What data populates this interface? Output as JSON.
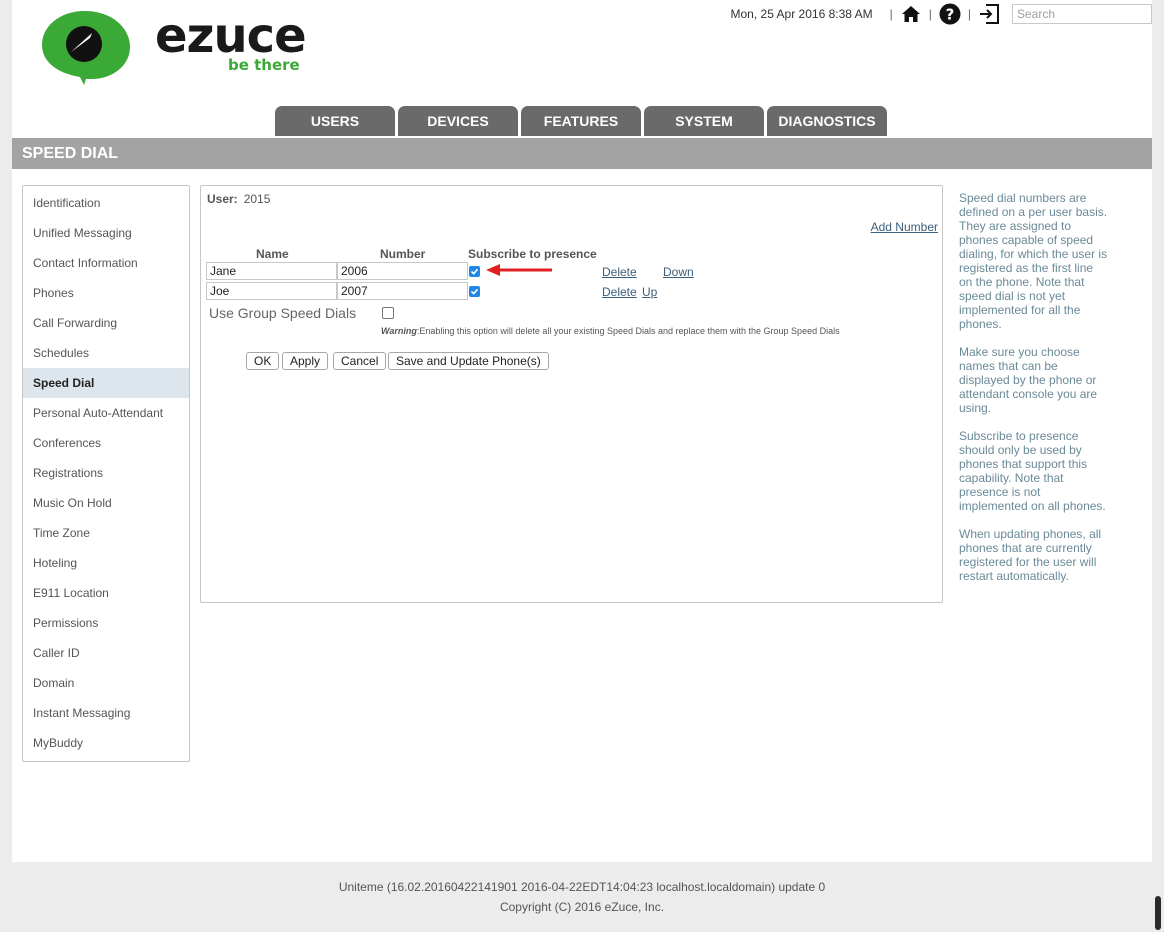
{
  "brand": {
    "name": "ezuce",
    "tagline": "be there",
    "colors": {
      "green": "#3aa935",
      "dark": "#1a1a1a"
    }
  },
  "header": {
    "datetime": "Mon, 25 Apr 2016 8:38 AM",
    "separator": "|",
    "search_placeholder": "Search",
    "icons": [
      "home-icon",
      "help-icon",
      "logout-icon"
    ]
  },
  "tabs": [
    {
      "label": "USERS"
    },
    {
      "label": "DEVICES"
    },
    {
      "label": "FEATURES"
    },
    {
      "label": "SYSTEM"
    },
    {
      "label": "DIAGNOSTICS"
    }
  ],
  "page_title": "SPEED DIAL",
  "sidebar": {
    "items": [
      {
        "label": "Identification"
      },
      {
        "label": "Unified Messaging"
      },
      {
        "label": "Contact Information"
      },
      {
        "label": "Phones"
      },
      {
        "label": "Call Forwarding"
      },
      {
        "label": "Schedules"
      },
      {
        "label": "Speed Dial",
        "active": true
      },
      {
        "label": "Personal Auto-Attendant"
      },
      {
        "label": "Conferences"
      },
      {
        "label": "Registrations"
      },
      {
        "label": "Music On Hold"
      },
      {
        "label": "Time Zone"
      },
      {
        "label": "Hoteling"
      },
      {
        "label": "E911 Location"
      },
      {
        "label": "Permissions"
      },
      {
        "label": "Caller ID"
      },
      {
        "label": "Domain"
      },
      {
        "label": "Instant Messaging"
      },
      {
        "label": "MyBuddy"
      }
    ]
  },
  "main": {
    "user_label": "User:",
    "user_value": "2015",
    "add_number": "Add Number",
    "columns": {
      "name": "Name",
      "number": "Number",
      "subscribe": "Subscribe to presence"
    },
    "rows": [
      {
        "name": "Jane",
        "number": "2006",
        "subscribe": true,
        "delete": "Delete",
        "move": "Down"
      },
      {
        "name": "Joe",
        "number": "2007",
        "subscribe": true,
        "delete": "Delete",
        "move": "Up"
      }
    ],
    "group_speed_dials_label": "Use Group Speed Dials",
    "group_speed_dials_checked": false,
    "warning_label": "Warning",
    "warning_text": ":Enabling this option will delete all your existing Speed Dials and replace them with the Group Speed Dials",
    "buttons": {
      "ok": "OK",
      "apply": "Apply",
      "cancel": "Cancel",
      "save_update": "Save and Update Phone(s)"
    },
    "annotation_arrow_color": "#e02020"
  },
  "help": {
    "paragraphs": [
      "Speed dial numbers are defined on a per user basis. They are assigned to phones capable of speed dialing, for which the user is registered as the first line on the phone. Note that speed dial is not yet implemented for all the phones.",
      "Make sure you choose names that can be displayed by the phone or attendant console you are using.",
      "Subscribe to presence should only be used by phones that support this capability. Note that presence is not implemented on all phones.",
      "When updating phones, all phones that are currently registered for the user will restart automatically."
    ]
  },
  "footer": {
    "version": "Uniteme (16.02.20160422141901 2016-04-22EDT14:04:23 localhost.localdomain) update 0",
    "copyright": "Copyright (C) 2016 eZuce, Inc."
  }
}
